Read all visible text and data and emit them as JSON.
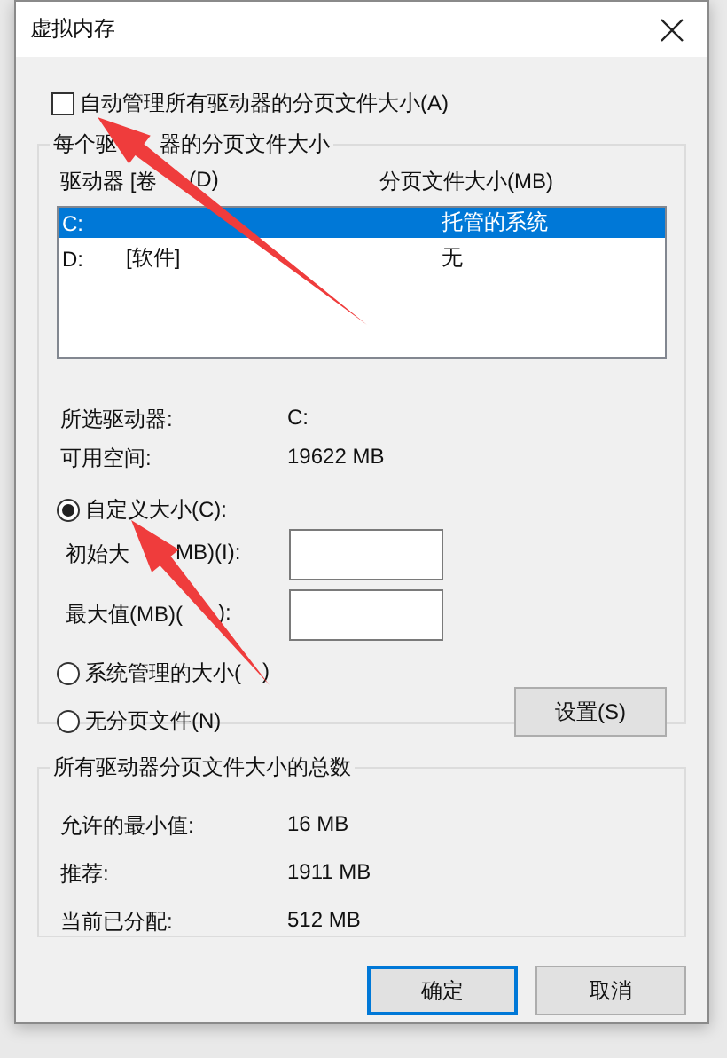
{
  "window": {
    "title": "虚拟内存"
  },
  "auto_manage": {
    "label": "自动管理所有驱动器的分页文件大小(A)",
    "checked": false
  },
  "per_drive": {
    "title": [
      "每个驱",
      "器的分页文件大小"
    ],
    "columns": [
      [
        "驱动器 [卷",
        "(D)"
      ],
      [
        "分页文件大小(MB)"
      ]
    ],
    "rows": [
      {
        "drive": "C:",
        "size": "托管的系统",
        "selected": true
      },
      {
        "drive": "D:",
        "label": "[软件]",
        "size": "无",
        "selected": false
      }
    ]
  },
  "selected_drive": [
    {
      "label": "所选驱动器:",
      "value": "C:"
    },
    {
      "label": "可用空间:",
      "value": "19622 MB"
    }
  ],
  "radios": [
    {
      "label": [
        "自定义大小(C):"
      ],
      "selected": true
    },
    {
      "label": [
        "系统管理的大小(",
        ")"
      ],
      "selected": false
    },
    {
      "label": [
        "无分页文件(N)"
      ],
      "selected": false
    }
  ],
  "fields": [
    {
      "label": [
        "初始大",
        "MB)(I):"
      ]
    },
    {
      "label": [
        "最大值(MB)(",
        "):"
      ]
    }
  ],
  "set_button": "设置(S)",
  "totals": {
    "title": "所有驱动器分页文件大小的总数",
    "rows": [
      {
        "label": "允许的最小值:",
        "value": "16 MB"
      },
      {
        "label": "推荐:",
        "value": "1911 MB"
      },
      {
        "label": "当前已分配:",
        "value": "512 MB"
      }
    ]
  },
  "buttons": [
    {
      "label": "确定",
      "default": true
    },
    {
      "label": "取消",
      "default": false
    }
  ],
  "annotations": [
    {
      "kind": "arrow"
    },
    {
      "kind": "arrow"
    }
  ]
}
